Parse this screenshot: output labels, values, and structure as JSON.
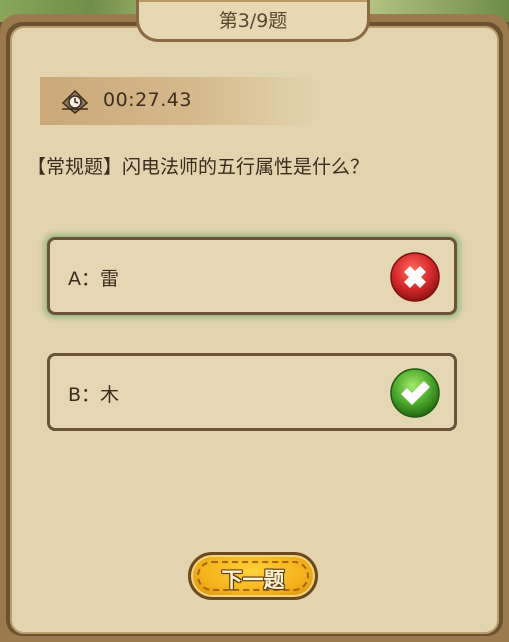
{
  "header": {
    "title": "第3/9题"
  },
  "timer": {
    "icon": "stopwatch-icon",
    "value": "00:27.43"
  },
  "question": {
    "text": "【常规题】闪电法师的五行属性是什么？"
  },
  "options": [
    {
      "label": "A：雷",
      "status": "wrong",
      "icon": "red-x-icon",
      "color": "#d8292b"
    },
    {
      "label": "B：木",
      "status": "correct",
      "icon": "green-check-icon",
      "color": "#4aa82a"
    }
  ],
  "next_button": {
    "label": "下一题"
  },
  "colors": {
    "panel": "#e2d4ae",
    "frame": "#6d5232",
    "accent": "#f4b11a"
  }
}
